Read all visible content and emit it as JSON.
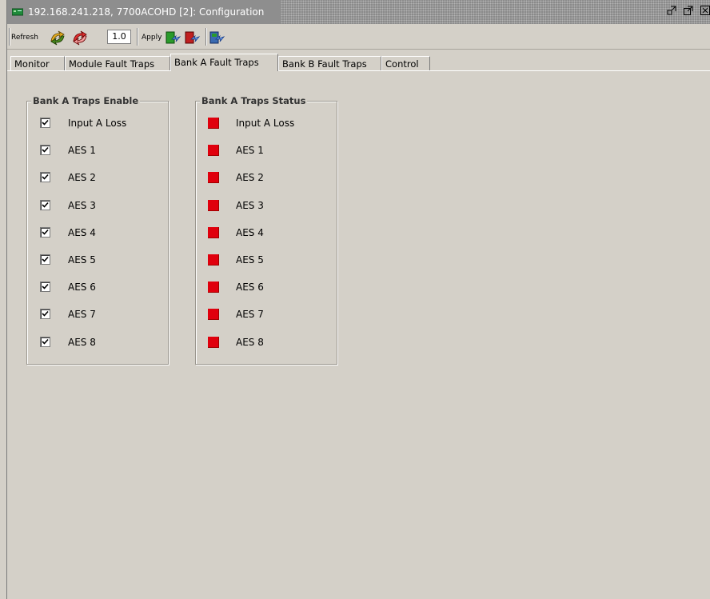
{
  "window": {
    "title": "192.168.241.218, 7700ACOHD  [2]: Configuration"
  },
  "toolbar": {
    "refresh_label": "Refresh",
    "version_value": "1.0",
    "apply_label": "Apply"
  },
  "tabs": [
    {
      "label": "Monitor",
      "active": false
    },
    {
      "label": "Module Fault Traps",
      "active": false
    },
    {
      "label": "Bank A Fault Traps",
      "active": true
    },
    {
      "label": "Bank B Fault Traps",
      "active": false
    },
    {
      "label": "Control",
      "active": false
    }
  ],
  "enable_group": {
    "title": "Bank A Traps Enable",
    "items": [
      {
        "label": "Input A Loss",
        "checked": true
      },
      {
        "label": "AES 1",
        "checked": true
      },
      {
        "label": "AES 2",
        "checked": true
      },
      {
        "label": "AES 3",
        "checked": true
      },
      {
        "label": "AES 4",
        "checked": true
      },
      {
        "label": "AES 5",
        "checked": true
      },
      {
        "label": "AES 6",
        "checked": true
      },
      {
        "label": "AES 7",
        "checked": true
      },
      {
        "label": "AES 8",
        "checked": true
      }
    ]
  },
  "status_group": {
    "title": "Bank A Traps Status",
    "status_color": "#e0000d",
    "items": [
      {
        "label": "Input A Loss"
      },
      {
        "label": "AES 1"
      },
      {
        "label": "AES 2"
      },
      {
        "label": "AES 3"
      },
      {
        "label": "AES 4"
      },
      {
        "label": "AES 5"
      },
      {
        "label": "AES 6"
      },
      {
        "label": "AES 7"
      },
      {
        "label": "AES 8"
      }
    ]
  }
}
